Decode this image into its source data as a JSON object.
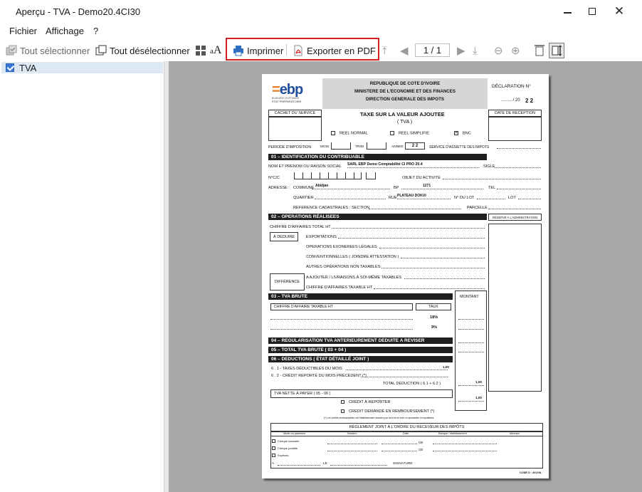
{
  "window": {
    "title": "Aperçu - TVA - Demo20.4CI30"
  },
  "menu": {
    "fichier": "Fichier",
    "affichage": "Affichage",
    "help": "?"
  },
  "toolbar": {
    "select_all": "Tout sélectionner",
    "deselect_all": "Tout désélectionner",
    "print": "Imprimer",
    "export_pdf": "Exporter en PDF",
    "page_indicator": "1 / 1"
  },
  "tree": {
    "item": "TVA"
  },
  "form": {
    "logo": "ebp",
    "logo_sub1": "BUSINESS SOFTWARE",
    "logo_sub2": "ÉTAT PRÉPARATOIRE",
    "header1": "REPUBLIQUE DE COTE D'IVOIRE",
    "header2": "MINISTERE DE L'ECONOMIE ET DES FINANCES",
    "header3": "DIRECTION GENERALE DES IMPOTS",
    "declaration": "DÉCLARATION N°",
    "year_prefix": "......... / 20",
    "year_digits": "2 2",
    "cachet": "CACHET DU SERVICE",
    "date_reception": "DATE DE RECEPTION",
    "tax_title": "TAXE SUR LA VALEUR AJOUTEE",
    "tax_sub": "( TVA )",
    "reel_normal": "REEL NORMAL",
    "reel_simplifie": "REEL SIMPLIFIE",
    "bnc": "BNC",
    "periode": "PERIODE D'IMPOSITION",
    "mois": "MOIS",
    "trim": "TRIM",
    "annee": "ANNEE",
    "annee_digits": "2  2",
    "service_assiette": "SERVICE D'ASSIETTE DES IMPOTS",
    "s01": "01 – IDENTIFICATION DU CONTRIBUABLE",
    "nom_label": "NOM ET PRENOM OU RAISON SOCIAL",
    "nom_value": "SARL EBP Demo Comptabilité CI PRO 20.4",
    "sigle": "SIGLE",
    "ncc": "N°C/C",
    "objet": "OBJET DU ACTIVITE",
    "adresse": "ADRESSE :",
    "commune": "COMMUNE",
    "commune_value": "Abidjan",
    "bp": "BP",
    "bp_value": "1271",
    "tel": "TEL",
    "quartier": "QUARTIER",
    "rue": "RUE",
    "rue_value": "PLATEAU DOKUI",
    "nlot": "N° DU LOT",
    "lot": "LOT",
    "ref_cad": "REFERENCE CADASTRALES :",
    "section": "SECTION",
    "parcelle": "PARCELLE",
    "s02": "02 – OPERATIONS RÉALISEES",
    "reserve": "RÉSERVÉ A L'ADMINISTRATION",
    "ca_total": "CHIFFRE D'AFFAIRES TOTAL HT",
    "a_deduire": "À DEDUIRE",
    "exportations": "EXPORTATIONS",
    "op_exonerees": "OPERATIONS EXONEREES LÉGALES",
    "conventionnelles": "CONVENTIONNELLES ( JOINDRE ATTESTATION )",
    "autres_op": "AUTRES OPÉRATIONS NON TAXABLES",
    "difference": "DIFFÉRENCE",
    "a_ajouter": "A AJOUTER / LIVRAISONS À SOI-MÊME TAXABLES",
    "ca_taxable": "CHIFFRE D'AFFAIRES TAXABLE HT",
    "s03": "03 – TVA BRUTE",
    "montant": "MONTANT",
    "ca_taxable2": "CHIFFRE D'AFFAIRE TAXABLE HT",
    "taux": "TAUX",
    "r18": "18%",
    "r9": "9%",
    "s04": "04 – REGULARISATION TVA ANTERIEUREMENT DEDUITE A REVISER",
    "s05": "05 – TOTAL TVA BRUTE ( 03 + 04 )",
    "s06": "06 – DEDUCTIONS ( ÉTAT DÉTAILLÉ JOINT )",
    "d61": "6 . 1 - TAXES DÉDUCTIBLES DU MOIS",
    "d62": "6 . 2 - CRÉDIT REPORTÉ DU MOIS PRÉCÉDENT (*)",
    "d61_value": "1,00",
    "total_deduction": "TOTAL DEDUCTION ( 6.1 + 6.2 )",
    "total_deduction_value": "1,00",
    "tva_nette": "TVA NETTE À PAYER ( 05 - 06 )",
    "tva_nette_value": "1,00",
    "credit_reporter": "CRÉDIT À REPORTER",
    "credit_rembourse": "CRÉDIT DEMANDÉ EN REMBOURSEMENT (*)",
    "credit_note": "(*) Les crédits remboursables ont l'établissement dossiers par la loi et ne sont ni reportables ni imputables",
    "reglement": "RÉGLEMENT JOINT À L'ORDRE DU RECEVEUR DES IMPÔTS",
    "col_mode": "Mode du paiement",
    "col_numero": "Numéro",
    "col_date": "Date",
    "col_banque": "Banque / établissement",
    "col_montant": "Montant",
    "p_cheque_bancaire": "Chèque bancaire",
    "p_cheque_postal": "Chèque postale",
    "p_especes": "Espèces",
    "date_line": "/20",
    "a_label": "A",
    "le_label": "LE",
    "signature": "SIGNATURE",
    "code": "CODE D : 201/VA"
  }
}
